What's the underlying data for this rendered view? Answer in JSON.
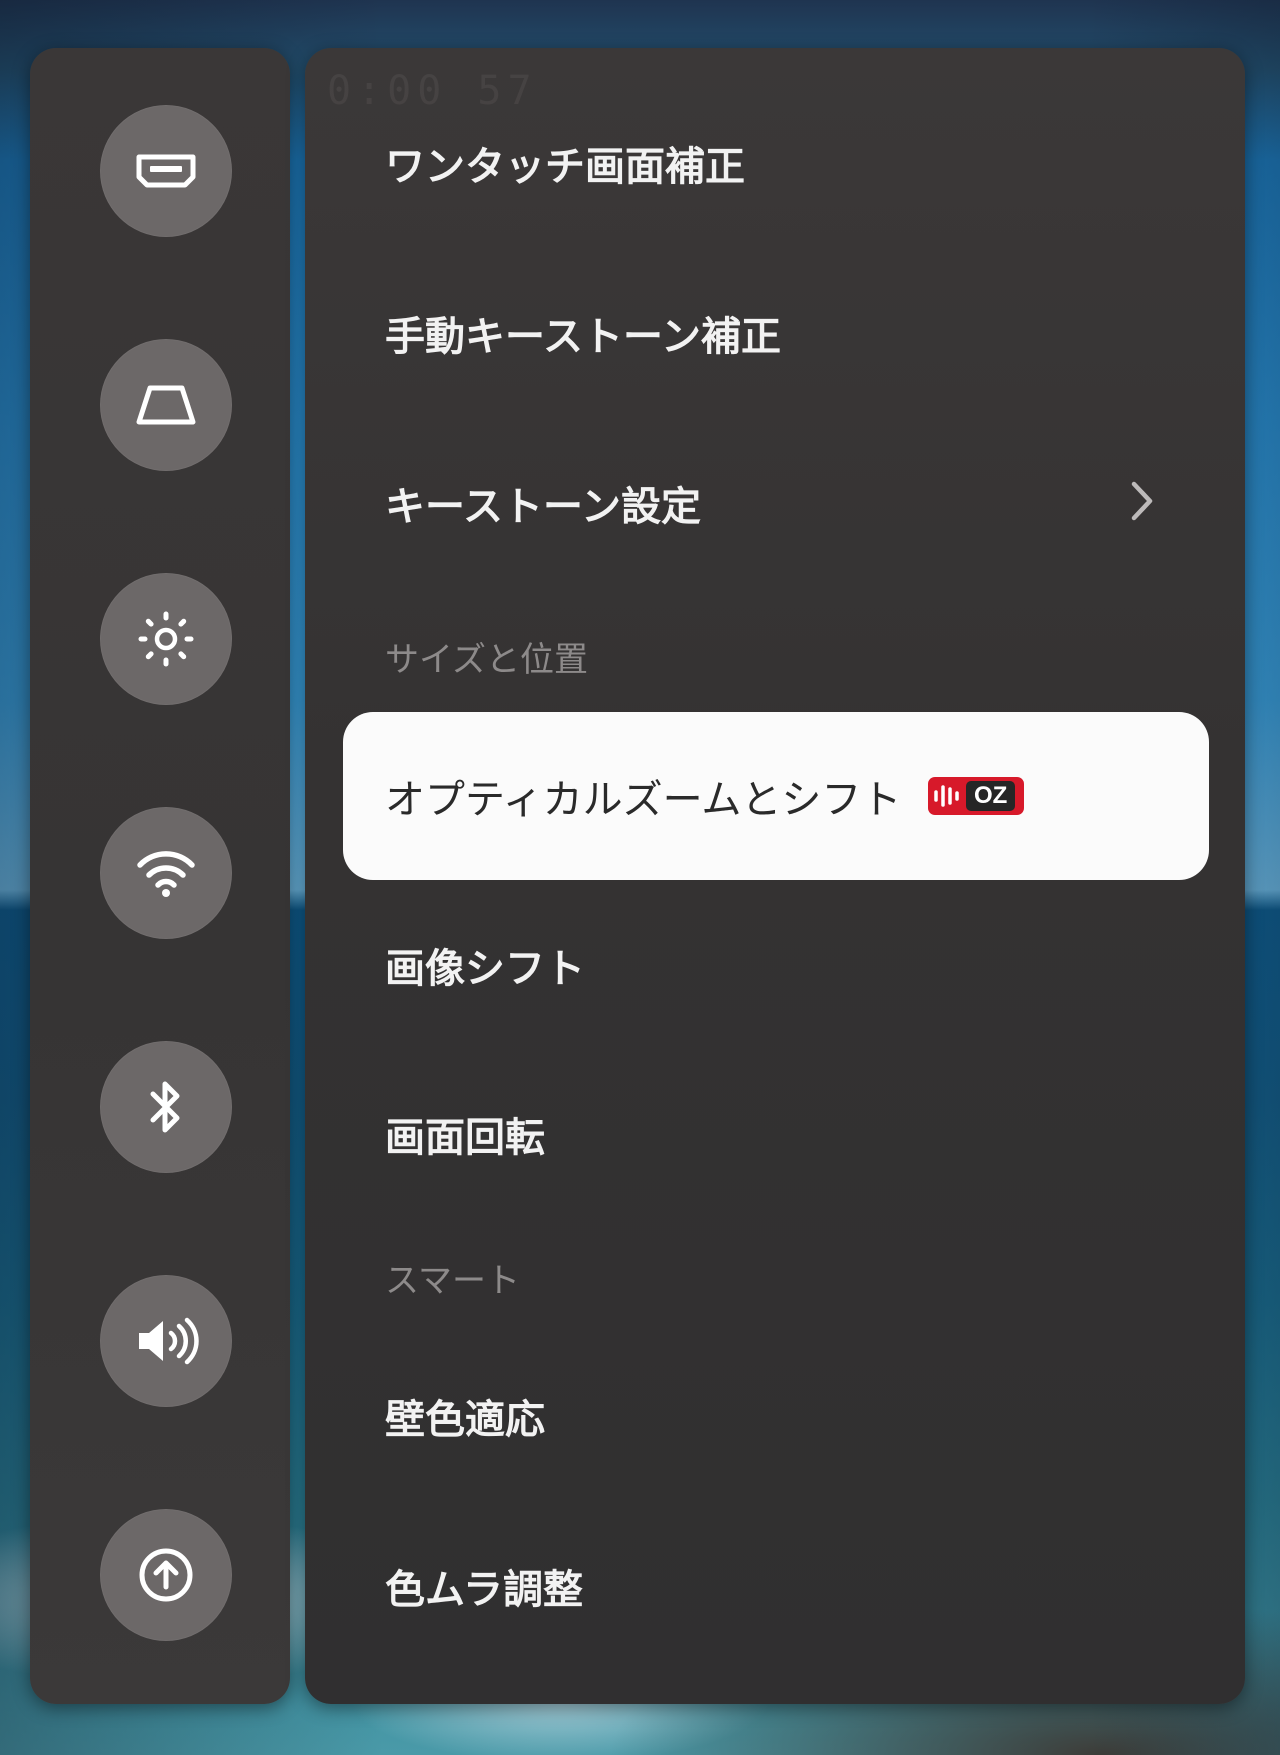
{
  "rail": {
    "icons": [
      {
        "name": "hdmi-input-icon"
      },
      {
        "name": "keystone-icon"
      },
      {
        "name": "brightness-icon"
      },
      {
        "name": "wifi-icon"
      },
      {
        "name": "bluetooth-icon"
      },
      {
        "name": "volume-icon"
      },
      {
        "name": "upload-icon"
      }
    ]
  },
  "panel": {
    "ghost_timer": "0:00 57",
    "items": {
      "one_touch": "ワンタッチ画面補正",
      "manual_keystone": "手動キーストーン補正",
      "keystone_settings": "キーストーン設定",
      "size_position_header": "サイズと位置",
      "optical_zoom": "オプティカルズームとシフト",
      "image_shift": "画像シフト",
      "screen_rotation": "画面回転",
      "smart_header": "スマート",
      "wall_color": "壁色適応",
      "color_unevenness": "色ムラ調整"
    },
    "badge": {
      "text": "OZ",
      "color": "#d7192a"
    }
  },
  "colors": {
    "panel_bg": "#363434",
    "selected_bg": "#fbfbfb",
    "icon_circle": "#6c6868"
  }
}
